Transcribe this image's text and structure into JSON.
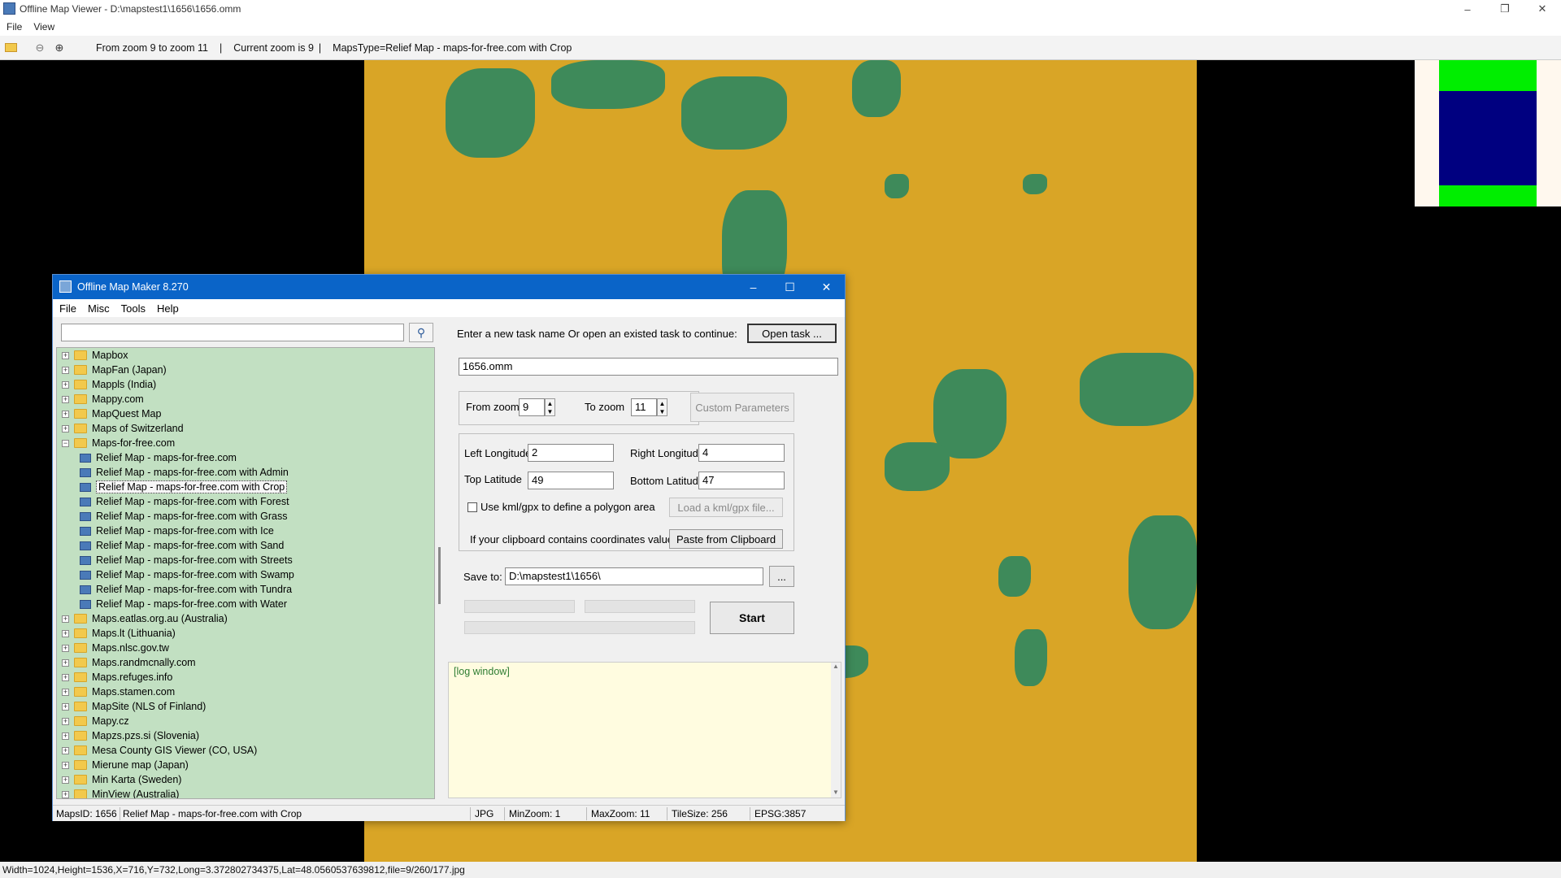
{
  "viewer": {
    "title": "Offline Map Viewer - D:\\mapstest1\\1656\\1656.omm",
    "menu": [
      "File",
      "View"
    ],
    "toolbar": {
      "zoom_range": "From zoom 9 to zoom 11",
      "current_zoom": "Current zoom is 9",
      "maps_type": "MapsType=Relief Map - maps-for-free.com with Crop"
    },
    "status": "Width=1024,Height=1536,X=716,Y=732,Long=3.372802734375,Lat=48.0560537639812,file=9/260/177.jpg",
    "icons": [
      "open-folder-icon",
      "zoom-out-icon",
      "zoom-in-icon"
    ]
  },
  "dialog": {
    "title": "Offline Map Maker 8.270",
    "menu": [
      "File",
      "Misc",
      "Tools",
      "Help"
    ],
    "search_value": "",
    "tree": [
      {
        "label": "Mapbox",
        "type": "folder"
      },
      {
        "label": "MapFan (Japan)",
        "type": "folder"
      },
      {
        "label": "Mappls (India)",
        "type": "folder"
      },
      {
        "label": "Mappy.com",
        "type": "folder"
      },
      {
        "label": "MapQuest Map",
        "type": "folder"
      },
      {
        "label": "Maps of Switzerland",
        "type": "folder"
      },
      {
        "label": "Maps-for-free.com",
        "type": "folder-open"
      },
      {
        "label": "Relief Map - maps-for-free.com",
        "type": "map"
      },
      {
        "label": "Relief Map - maps-for-free.com with Admin",
        "type": "map"
      },
      {
        "label": "Relief Map - maps-for-free.com with Crop",
        "type": "map",
        "selected": true
      },
      {
        "label": "Relief Map - maps-for-free.com with Forest",
        "type": "map"
      },
      {
        "label": "Relief Map - maps-for-free.com with Grass",
        "type": "map"
      },
      {
        "label": "Relief Map - maps-for-free.com with Ice",
        "type": "map"
      },
      {
        "label": "Relief Map - maps-for-free.com with Sand",
        "type": "map"
      },
      {
        "label": "Relief Map - maps-for-free.com with Streets",
        "type": "map"
      },
      {
        "label": "Relief Map - maps-for-free.com with Swamp",
        "type": "map"
      },
      {
        "label": "Relief Map - maps-for-free.com with Tundra",
        "type": "map"
      },
      {
        "label": "Relief Map - maps-for-free.com with Water",
        "type": "map"
      },
      {
        "label": "Maps.eatlas.org.au (Australia)",
        "type": "folder"
      },
      {
        "label": "Maps.lt (Lithuania)",
        "type": "folder"
      },
      {
        "label": "Maps.nlsc.gov.tw",
        "type": "folder"
      },
      {
        "label": "Maps.randmcnally.com",
        "type": "folder"
      },
      {
        "label": "Maps.refuges.info",
        "type": "folder"
      },
      {
        "label": "Maps.stamen.com",
        "type": "folder"
      },
      {
        "label": "MapSite (NLS of Finland)",
        "type": "folder"
      },
      {
        "label": "Mapy.cz",
        "type": "folder"
      },
      {
        "label": "Mapzs.pzs.si (Slovenia)",
        "type": "folder"
      },
      {
        "label": "Mesa County GIS Viewer (CO, USA)",
        "type": "folder"
      },
      {
        "label": "Mierune map (Japan)",
        "type": "folder"
      },
      {
        "label": "Min Karta (Sweden)",
        "type": "folder"
      },
      {
        "label": "MinView (Australia)",
        "type": "folder"
      }
    ],
    "task_prompt": "Enter a new task name Or open an existed task to continue:",
    "open_task_label": "Open task ...",
    "task_name": "1656.omm",
    "from_zoom_label": "From zoom",
    "from_zoom": "9",
    "to_zoom_label": "To zoom",
    "to_zoom": "11",
    "custom_params_label": "Custom Parameters",
    "left_lon_label": "Left Longitude",
    "left_lon": "2",
    "right_lon_label": "Right Longitude",
    "right_lon": "4",
    "top_lat_label": "Top Latitude",
    "top_lat": "49",
    "bottom_lat_label": "Bottom Latitude",
    "bottom_lat": "47",
    "kml_label": "Use kml/gpx to define a polygon area",
    "load_kml_label": "Load a kml/gpx file...",
    "clipboard_prompt": "If your clipboard contains coordinates values:",
    "paste_label": "Paste from Clipboard",
    "save_to_label": "Save to:",
    "save_to": "D:\\mapstest1\\1656\\",
    "browse_label": "...",
    "start_label": "Start",
    "log_text": "[log window]",
    "status": {
      "maps_id": "MapsID: 1656",
      "map_name": "Relief Map - maps-for-free.com with Crop",
      "format": "JPG",
      "min_zoom": "MinZoom: 1",
      "max_zoom": "MaxZoom: 11",
      "tile_size": "TileSize: 256",
      "epsg": "EPSG:3857"
    }
  },
  "colors": {
    "map_base": "#d9a526",
    "forest": "#3e8a5a",
    "tree_bg": "#c2e0c2",
    "title_blue": "#0a64c8",
    "log_bg": "#fffce0"
  }
}
